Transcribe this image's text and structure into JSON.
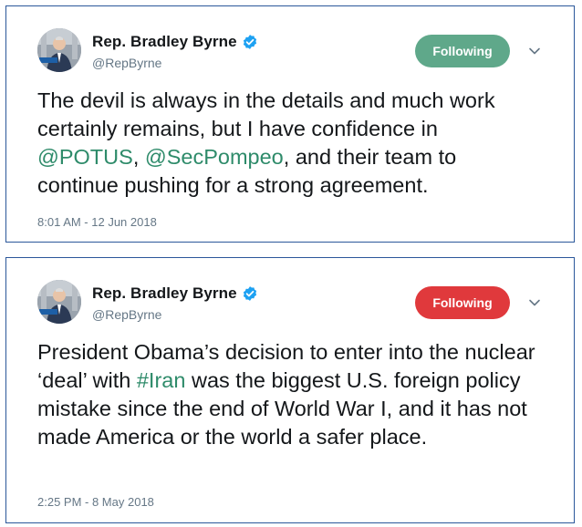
{
  "colors": {
    "card_border": "#2b579a",
    "link": "#2e8b6a",
    "follow_green": "#5fa88a",
    "follow_red": "#e0393c",
    "verified_blue": "#1da1f2"
  },
  "tweets": [
    {
      "author": {
        "name": "Rep. Bradley Byrne",
        "handle": "@RepByrne",
        "verified": true,
        "avatar_icon": "person-photo-icon"
      },
      "follow_button": {
        "label": "Following",
        "color": "#5fa88a"
      },
      "caret_icon": "chevron-down-icon",
      "text": {
        "p1": "The devil is always in the details and much work certainly remains, but I have confidence in ",
        "mention1": "@POTUS",
        "p2": ", ",
        "mention2": "@SecPompeo",
        "p3": ", and their team to continue pushing for a strong agreement."
      },
      "timestamp": "8:01 AM - 12 Jun 2018"
    },
    {
      "author": {
        "name": "Rep. Bradley Byrne",
        "handle": "@RepByrne",
        "verified": true,
        "avatar_icon": "person-photo-icon"
      },
      "follow_button": {
        "label": "Following",
        "color": "#e0393c"
      },
      "caret_icon": "chevron-down-icon",
      "text": {
        "p1": "President Obama’s decision to enter into the nuclear ‘deal’ with ",
        "hashtag": "#Iran",
        "p2": " was the biggest U.S. foreign policy mistake since the end of World War I, and it has not made America or the world a safer place."
      },
      "timestamp": "2:25 PM - 8 May 2018"
    }
  ]
}
